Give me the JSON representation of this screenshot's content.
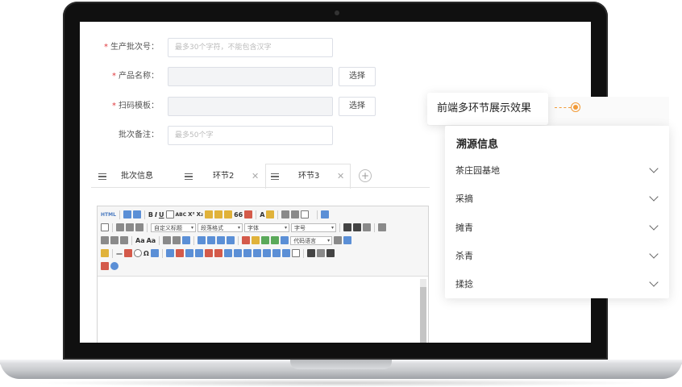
{
  "form": {
    "fields": [
      {
        "label": "生产批次号：",
        "required": true,
        "placeholder": "最多30个字符，不能包含汉字"
      },
      {
        "label": "产品名称：",
        "required": true,
        "placeholder": "",
        "button": "选择"
      },
      {
        "label": "扫码模板：",
        "required": true,
        "placeholder": "",
        "button": "选择"
      },
      {
        "label": "批次备注：",
        "required": false,
        "placeholder": "最多50个字"
      }
    ]
  },
  "tabs": [
    {
      "label": "批次信息",
      "closable": false
    },
    {
      "label": "环节2",
      "closable": true
    },
    {
      "label": "环节3",
      "closable": true
    }
  ],
  "editor": {
    "html_label": "HTML",
    "heading_select": "自定义标题",
    "paragraph_select": "段落格式",
    "font_select": "字体",
    "size_select": "字号",
    "code_select": "代码语言"
  },
  "callout": {
    "text": "前端多环节展示效果"
  },
  "panel": {
    "title": "溯源信息",
    "items": [
      "茶庄园基地",
      "采摘",
      "摊青",
      "杀青",
      "揉捻"
    ]
  },
  "colors": {
    "accent": "#f29b38",
    "required": "#e0393e"
  }
}
